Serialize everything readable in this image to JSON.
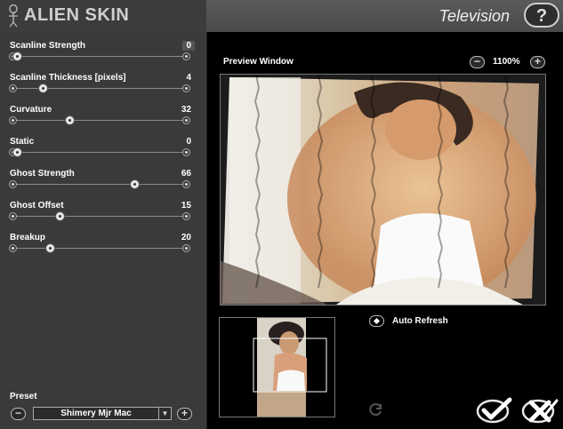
{
  "header": {
    "brand": "ALIEN SKIN",
    "filter_title": "Television",
    "help_label": "?"
  },
  "controls": [
    {
      "label": "Scanline Strength",
      "value": "0",
      "fraction": 0.0,
      "boxed": true
    },
    {
      "label": "Scanline Thickness [pixels]",
      "value": "4",
      "fraction": 0.16
    },
    {
      "label": "Curvature",
      "value": "32",
      "fraction": 0.32
    },
    {
      "label": "Static",
      "value": "0",
      "fraction": 0.0
    },
    {
      "label": "Ghost Strength",
      "value": "66",
      "fraction": 0.72
    },
    {
      "label": "Ghost Offset",
      "value": "15",
      "fraction": 0.26
    },
    {
      "label": "Breakup",
      "value": "20",
      "fraction": 0.2
    }
  ],
  "preset": {
    "label": "Preset",
    "value": "Shimery Mjr Mac",
    "minus": "−",
    "plus": "+"
  },
  "preview": {
    "label": "Preview Window",
    "zoom": "1100%",
    "zoom_minus": "−",
    "zoom_plus": "+"
  },
  "auto_refresh": {
    "label": "Auto Refresh",
    "checked": true
  },
  "icons": {
    "logo": "alien-figure-icon",
    "help": "help-icon",
    "refresh": "refresh-icon",
    "ok": "checkmark-icon",
    "cancel": "cancel-x-icon"
  },
  "colors": {
    "panel": "#3a3a3a",
    "header": "#4a4a4a",
    "background": "#000000"
  }
}
